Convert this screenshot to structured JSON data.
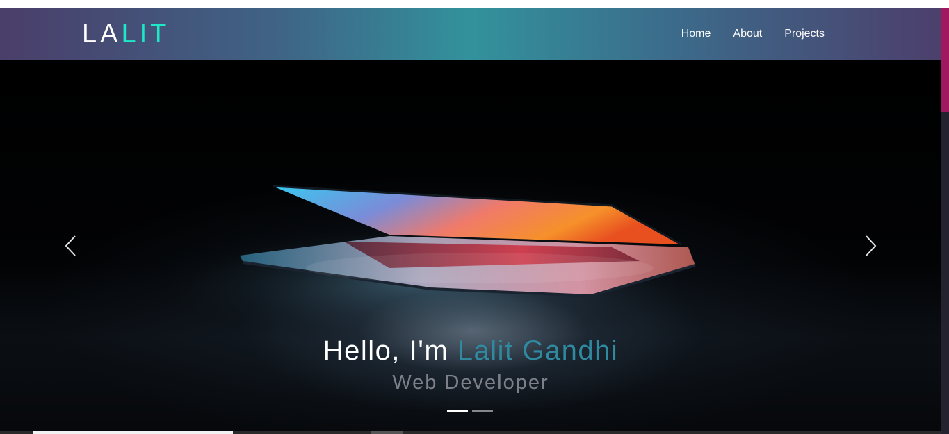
{
  "brand": {
    "logo_part1": "LA",
    "logo_part2": "LIT",
    "logo_part2_color": "#1de9c8"
  },
  "nav": {
    "items": [
      {
        "label": "Home"
      },
      {
        "label": "About"
      },
      {
        "label": "Projects"
      }
    ]
  },
  "hero": {
    "headline_prefix": "Hello, I'm ",
    "headline_name": "Lalit Gandhi",
    "name_color": "#2f8aa0",
    "subtitle": "Web Developer",
    "prev_icon": "chevron-left-icon",
    "next_icon": "chevron-right-icon",
    "slide_count": 2,
    "active_slide": 1
  },
  "theme": {
    "navbar_gradient": [
      "#4a3e6a",
      "#32929c",
      "#4c3f6c"
    ],
    "scroll_thumb_color": "#a01860"
  }
}
